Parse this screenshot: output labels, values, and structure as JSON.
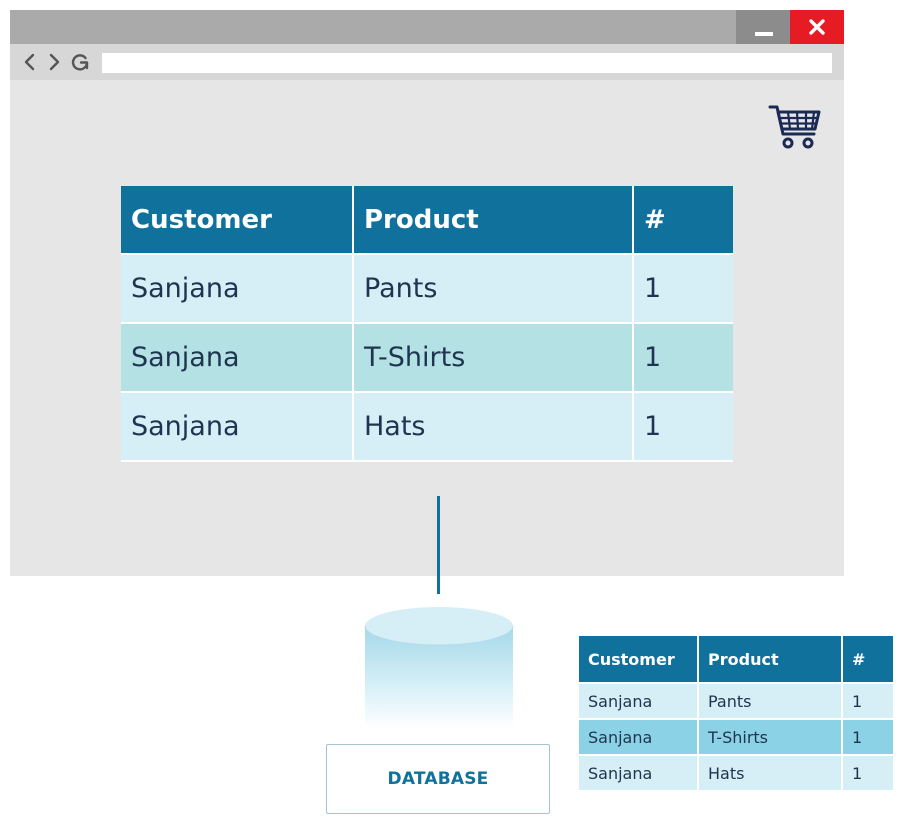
{
  "colors": {
    "header_blue": "#10719c",
    "row_light": "#d6eef5",
    "row_dark_browser": "#b4e1e4",
    "row_dark_db": "#8bd2e6",
    "close_red": "#e61b24",
    "cart_navy": "#1b2a55"
  },
  "browser": {
    "window_controls": {
      "minimize_icon": "minimize-icon",
      "close_icon": "close-icon"
    },
    "nav_icons": [
      "back-icon",
      "forward-icon",
      "reload-icon"
    ],
    "cart_icon": "shopping-cart-icon",
    "orders_table": {
      "columns": [
        "Customer",
        "Product",
        "#"
      ],
      "rows": [
        [
          "Sanjana",
          "Pants",
          "1"
        ],
        [
          "Sanjana",
          "T-Shirts",
          "1"
        ],
        [
          "Sanjana",
          "Hats",
          "1"
        ]
      ]
    }
  },
  "database": {
    "label": "DATABASE",
    "table": {
      "columns": [
        "Customer",
        "Product",
        "#"
      ],
      "rows": [
        [
          "Sanjana",
          "Pants",
          "1"
        ],
        [
          "Sanjana",
          "T-Shirts",
          "1"
        ],
        [
          "Sanjana",
          "Hats",
          "1"
        ]
      ]
    }
  }
}
